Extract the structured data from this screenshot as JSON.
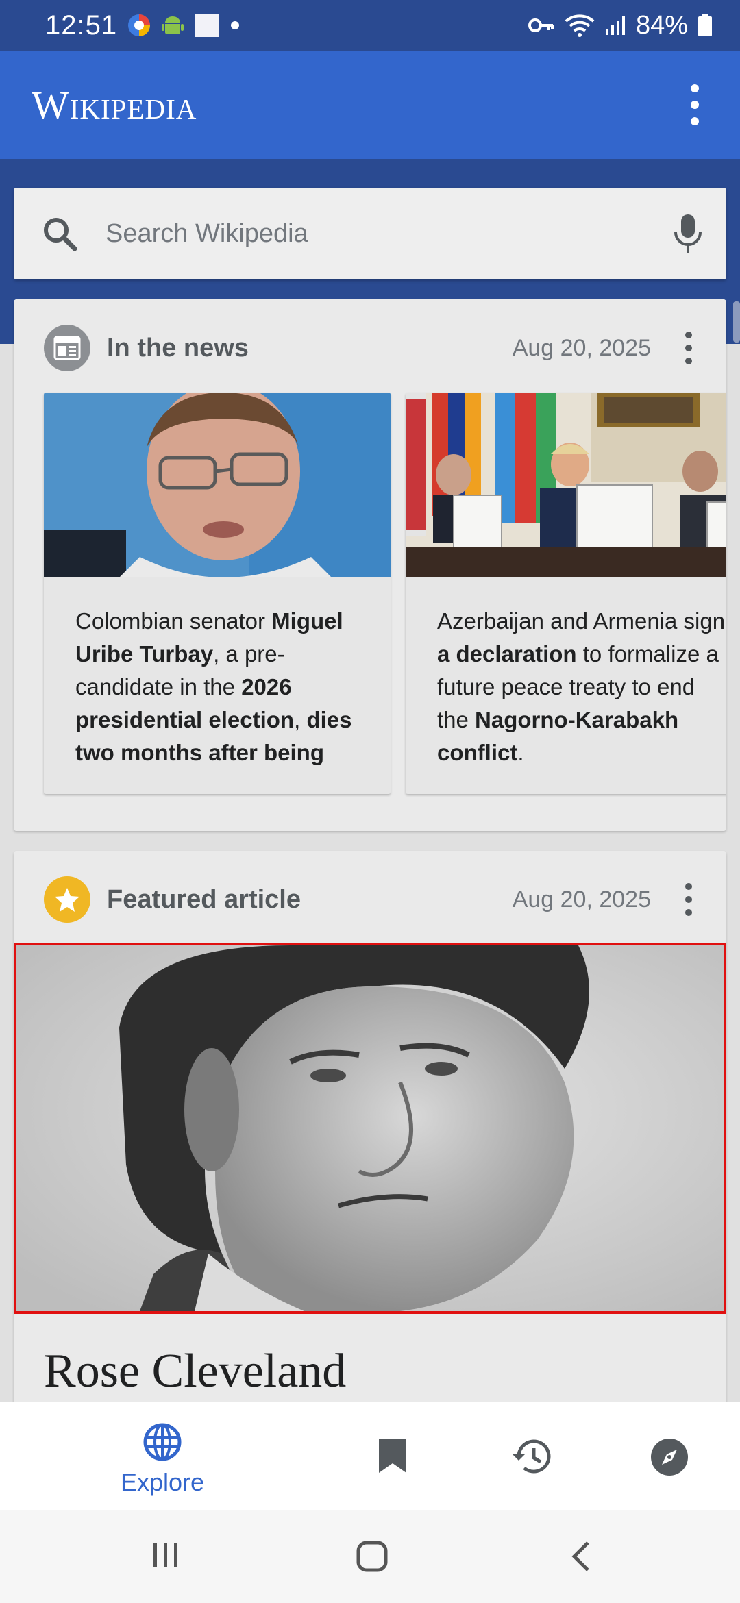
{
  "status_bar": {
    "time": "12:51",
    "battery": "84%",
    "icons": [
      "browser-icon",
      "android-icon",
      "notification-square-icon",
      "dot-icon",
      "vpn-key-icon",
      "wifi-icon",
      "signal-icon",
      "battery-icon"
    ]
  },
  "app_bar": {
    "logo": "Wikipedia",
    "menu_icon": "overflow-menu-icon"
  },
  "search": {
    "placeholder": "Search Wikipedia"
  },
  "news_card": {
    "title": "In the news",
    "date": "Aug 20, 2025",
    "items": [
      {
        "parts": [
          "Colombian senator ",
          "Miguel Uribe Turbay",
          ", a pre-candidate in the ",
          "2026 presidential election",
          ", ",
          "dies two months after being s…"
        ]
      },
      {
        "parts": [
          "Azerbaijan and Armenia sign ",
          "a declaration",
          " to formalize a future peace treaty to end the ",
          "Nagorno-Karabakh conflict",
          "."
        ]
      }
    ]
  },
  "featured_card": {
    "title": "Featured article",
    "date": "Aug 20, 2025",
    "article_title": "Rose Cleveland"
  },
  "bottom_nav": {
    "explore_label": "Explore",
    "items": [
      "explore-globe-icon",
      "saved-bookmark-icon",
      "history-icon",
      "places-compass-icon"
    ]
  },
  "colors": {
    "status_bar": "#2a4a91",
    "app_bar": "#3366cc",
    "accent": "#3366cc",
    "featured_star": "#f0b724",
    "highlight_border": "#e01010"
  }
}
